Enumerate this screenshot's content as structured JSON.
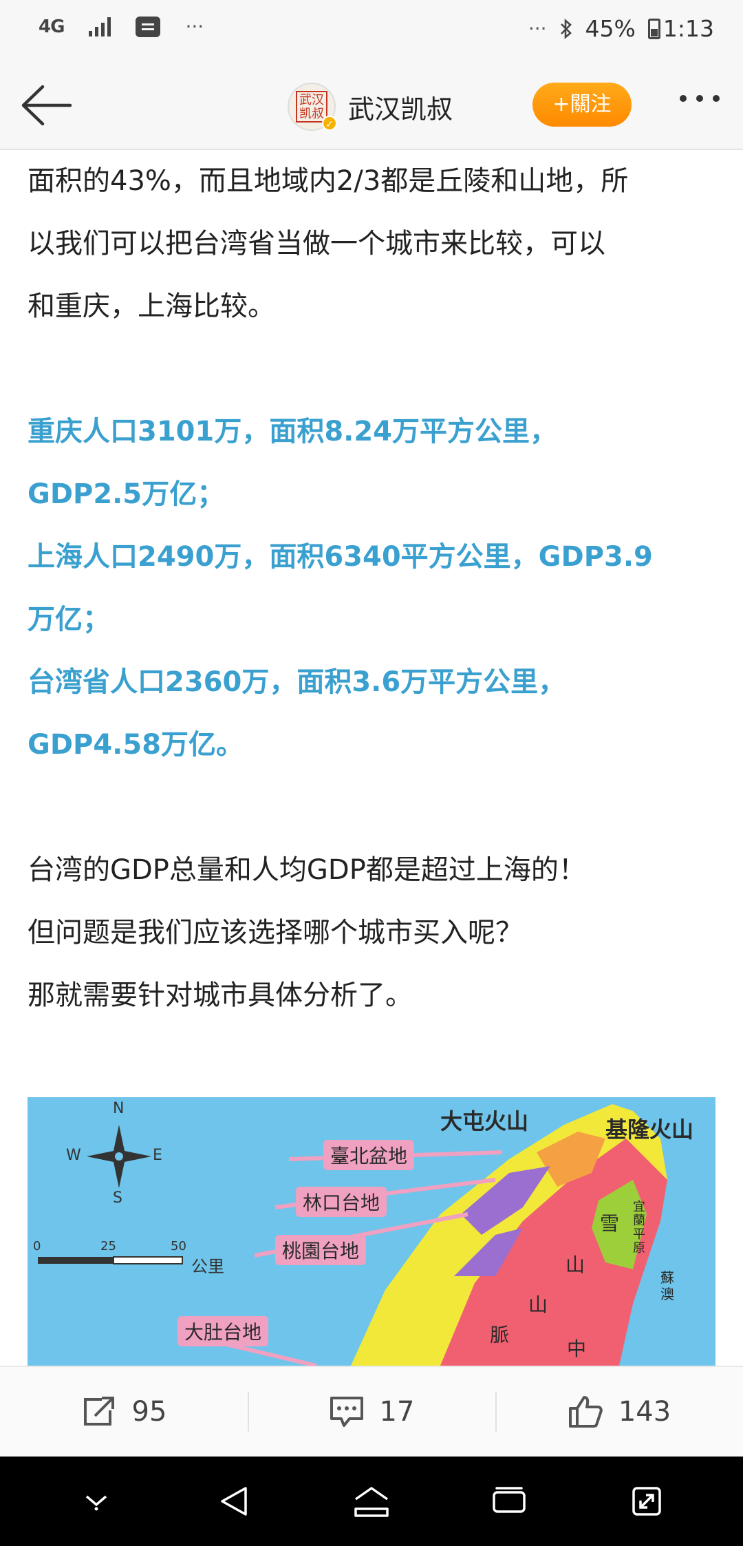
{
  "status_bar": {
    "network": "4G",
    "overflow_left": "···",
    "overflow_right": "···",
    "battery": "45%",
    "time": "1:13"
  },
  "header": {
    "author_name": "武汉凯叔",
    "avatar_text": "武汉凯叔",
    "follow_label": "+關注"
  },
  "article": {
    "intro_lines": [
      "面积的43%，而且地域内2/3都是丘陵和山地，所",
      "以我们可以把台湾省当做一个城市来比较，可以",
      "和重庆，上海比较。"
    ],
    "highlight_lines": [
      "重庆人口3101万，面积8.24万平方公里，",
      "GDP2.5万亿；",
      "上海人口2490万，面积6340平方公里，GDP3.9",
      "万亿；",
      "台湾省人口2360万，面积3.6万平方公里，",
      "GDP4.58万亿。"
    ],
    "closing_lines": [
      "台湾的GDP总量和人均GDP都是超过上海的！",
      "但问题是我们应该选择哪个城市买入呢？",
      "那就需要针对城市具体分析了。"
    ]
  },
  "map": {
    "labels": {
      "datun": "大屯火山",
      "keelung": "基隆火山",
      "taipei": "臺北盆地",
      "linkou": "林口台地",
      "taoyuan": "桃園台地",
      "dadu": "大肚台地",
      "xue": "雪",
      "shan": "山",
      "shan2": "山",
      "mai": "脈",
      "zhong": "中",
      "yilan": "宜蘭平原",
      "suao": "蘇澳"
    },
    "compass": {
      "n": "N",
      "s": "S",
      "e": "E",
      "w": "W"
    },
    "scale": {
      "zero": "0",
      "mid": "25",
      "max": "50",
      "unit": "公里"
    }
  },
  "actions": {
    "share_count": "95",
    "comment_count": "17",
    "like_count": "143"
  }
}
